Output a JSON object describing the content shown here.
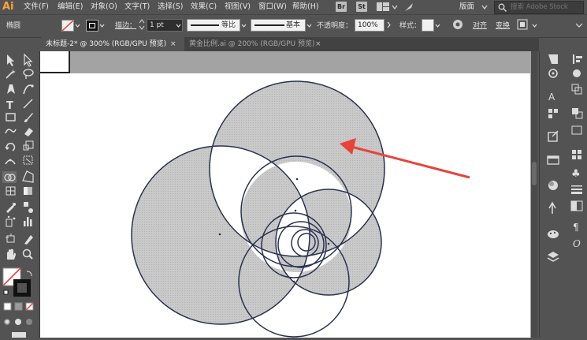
{
  "app": {
    "logo_text": "Ai",
    "menu": [
      "文件(F)",
      "编辑(E)",
      "对象(O)",
      "文字(T)",
      "选择(S)",
      "效果(C)",
      "视图(V)",
      "窗口(W)",
      "帮助(H)"
    ],
    "bridge_badge": "Br",
    "stock_badge": "St",
    "workspace_label": "版面",
    "search_placeholder": "搜索 Adobe Stock"
  },
  "control_bar": {
    "selection_label": "椭圆",
    "stroke_label": "描边：",
    "stroke_value": "1 pt",
    "profile_label": "等比",
    "brush_label": "基本",
    "opacity_label": "不透明度：",
    "opacity_value": "100%",
    "style_label": "样式：",
    "align_label": "对齐",
    "transform_label": "变换"
  },
  "tabs": [
    {
      "label": "未标题-2* @ 300% (RGB/GPU 预览)",
      "active": true
    },
    {
      "label": "黄金比例.ai @ 200% (RGB/GPU 预览)",
      "active": false
    }
  ],
  "colors": {
    "ui_dark": "#535353",
    "circle_stroke": "#2a3050",
    "fill_gray": "#c8c8c8",
    "arrow_red": "#e8433a",
    "logo_orange": "#f7a23d"
  },
  "icons": {
    "toolbar": [
      "selection-arrow-icon",
      "direct-selection-icon",
      "magic-wand-icon",
      "lasso-icon",
      "pen-icon",
      "curvature-icon",
      "type-icon",
      "line-segment-icon",
      "rectangle-icon",
      "paintbrush-icon",
      "shaper-icon",
      "eraser-icon",
      "rotate-icon",
      "scale-icon",
      "width-icon",
      "free-transform-icon",
      "shape-builder-icon",
      "perspective-grid-icon",
      "mesh-icon",
      "gradient-icon",
      "eyedropper-icon",
      "blend-icon",
      "symbol-sprayer-icon",
      "column-graph-icon",
      "artboard-icon",
      "slice-icon",
      "hand-icon",
      "zoom-icon"
    ],
    "right_panel": [
      "libraries-icon",
      "color-guide-icon",
      "type-panel-icon",
      "properties-icon",
      "export-icon",
      "swatches-icon",
      "symbols-icon",
      "stroke-panel-icon",
      "appearance-icon",
      "layers-icon"
    ]
  }
}
